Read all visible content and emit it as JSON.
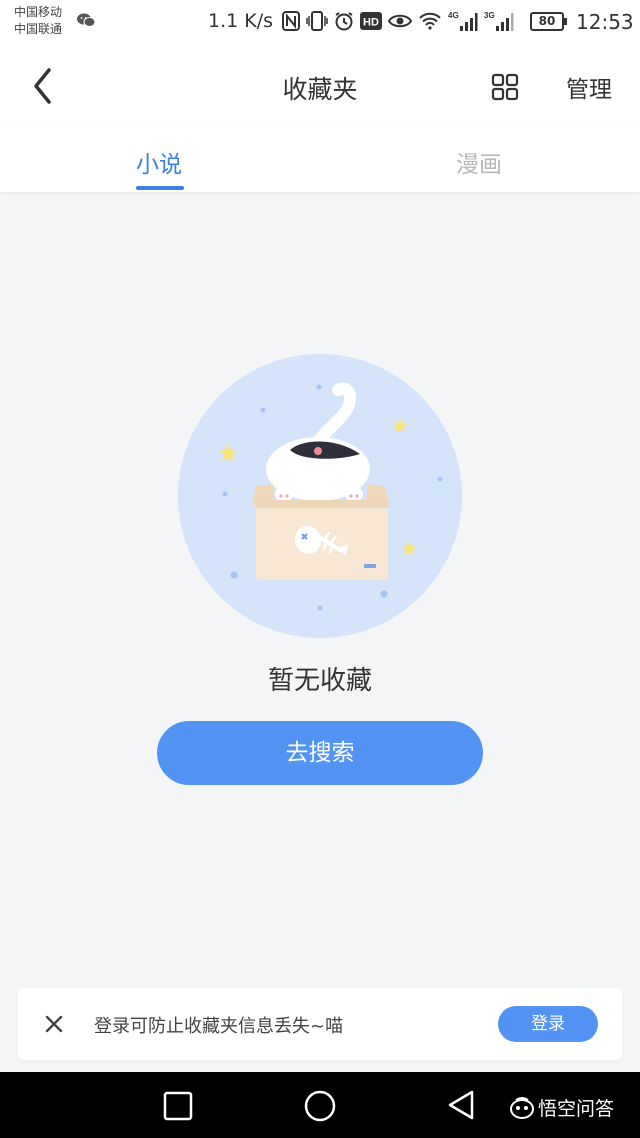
{
  "status_bar": {
    "carrier_1": "中国移动",
    "carrier_2": "中国联通",
    "net_speed": "1.1 K/s",
    "battery": "80",
    "time": "12:53",
    "signal_1_label": "4G",
    "signal_2_label": "3G",
    "hd_label": "HD",
    "icons": [
      "wechat-icon",
      "nfc-icon",
      "vibrate-icon",
      "alarm-icon",
      "hd-icon",
      "eye-icon",
      "wifi-icon",
      "signal-4g-icon",
      "signal-3g-icon",
      "battery-icon"
    ]
  },
  "header": {
    "title": "收藏夹",
    "manage_label": "管理",
    "icons": [
      "back-arrow-icon",
      "grid-view-icon"
    ]
  },
  "tabs": [
    {
      "label": "小说",
      "active": true
    },
    {
      "label": "漫画",
      "active": false
    }
  ],
  "empty_state": {
    "message": "暂无收藏",
    "button_label": "去搜索",
    "illustration": "cat-in-box-illustration"
  },
  "login_banner": {
    "message": "登录可防止收藏夹信息丢失~喵",
    "button_label": "登录",
    "close_icon": "close-icon"
  },
  "system_nav": {
    "icons": [
      "recent-apps-icon",
      "home-icon",
      "back-triangle-icon"
    ]
  },
  "watermark": {
    "text": "悟空问答"
  },
  "colors": {
    "accent": "#3d7fe7",
    "button": "#5293f3",
    "background": "#f4f5f7",
    "inactive_tab": "#b8b8b8"
  }
}
